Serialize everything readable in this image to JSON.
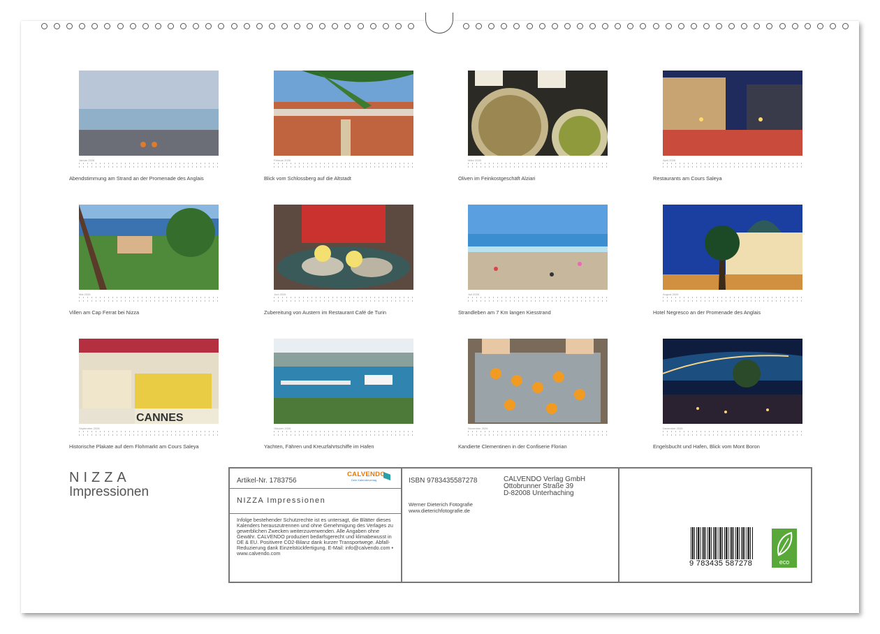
{
  "months": [
    {
      "month": "Januar 2026",
      "caption": "Abendstimmung am Strand an der Promenade des Anglais"
    },
    {
      "month": "Februar 2026",
      "caption": "Blick vom Schlossberg auf die Altstadt"
    },
    {
      "month": "März 2026",
      "caption": "Oliven im Feinkostgeschäft Alziari"
    },
    {
      "month": "April 2026",
      "caption": "Restaurants am Cours Saleya"
    },
    {
      "month": "Mai 2026",
      "caption": "Villen am Cap Ferrat bei Nizza"
    },
    {
      "month": "Juni 2026",
      "caption": "Zubereitung von Austern im Restaurant Café de Turin"
    },
    {
      "month": "Juli 2026",
      "caption": "Strandleben am 7 Km langen Kiesstrand"
    },
    {
      "month": "August 2026",
      "caption": "Hotel Negresco an der Promenade des Anglais"
    },
    {
      "month": "September 2026",
      "caption": "Historische Plakate auf dem Flohmarkt am Cours Saleya"
    },
    {
      "month": "Oktober 2026",
      "caption": "Yachten, Fähren und Kreuzfahrtschiffe im Hafen"
    },
    {
      "month": "November 2026",
      "caption": "Kandierte Clementinen in der Confiserie Florian"
    },
    {
      "month": "Dezember 2026",
      "caption": "Engelsbucht und Hafen, Blick vom Mont Boron"
    }
  ],
  "title": "NIZZA",
  "subtitle": "Impressionen",
  "info": {
    "article": "Artikel-Nr. 1783756",
    "logo_word": "CALVENDO",
    "logo_tag": "Dein Kalenderverlag",
    "product_title": "NIZZA Impressionen",
    "legal": "Infolge bestehender Schutzrechte ist es untersagt, die Blätter dieses Kalenders herauszutrennen und ohne Genehmigung des Verlages zu gewerblichen Zwecken weiterzuverwenden. Alle Angaben ohne Gewähr. CALVENDO produziert bedarfsgerecht und klimabewusst in DE & EU. Positivere CO2-Bilanz dank kurzer Transportwege. Abfall-Reduzierung dank Einzelstückfertigung. E-Mail: info@calvendo.com • www.calvendo.com",
    "isbn": "ISBN 9783435587278",
    "publisher_lines": [
      "CALVENDO Verlag GmbH",
      "Ottobrunner Straße 39",
      "D-82008 Unterhaching"
    ],
    "photographer": "Werner Dieterich Fotografie",
    "website": "www.dieterichfotografie.de",
    "barcode_number": "9 783435 587278",
    "eco_label": "eco"
  }
}
